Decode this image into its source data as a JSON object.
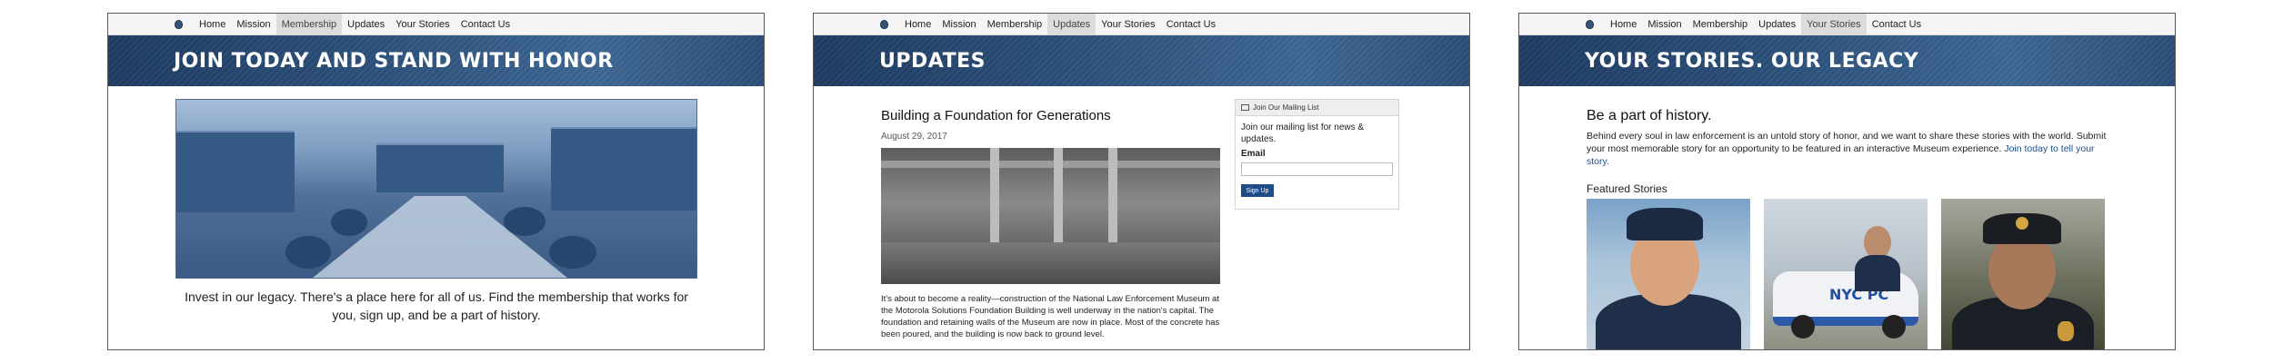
{
  "nav": {
    "items": [
      "Home",
      "Mission",
      "Membership",
      "Updates",
      "Your Stories",
      "Contact Us"
    ]
  },
  "screens": [
    {
      "active_nav": "Membership",
      "banner_title": "JOIN TODAY AND STAND WITH HONOR",
      "intro_text": "Invest in our legacy. There's a place here for all of us. Find the membership that works for you, sign up, and be a part of history."
    },
    {
      "active_nav": "Updates",
      "banner_title": "UPDATES",
      "post": {
        "title": "Building a Foundation for Generations",
        "date": "August 29, 2017",
        "body": "It's about to become a reality—construction of the National Law Enforcement Museum at the Motorola Solutions Foundation Building is well underway in the nation's capital. The foundation and retaining walls of the Museum are now in place. Most of the concrete has been poured, and the building is now back to ground level."
      },
      "mailing": {
        "header": "Join Our Mailing List",
        "text": "Join our mailing list for news & updates.",
        "email_label": "Email",
        "email_value": "",
        "button": "Sign Up"
      }
    },
    {
      "active_nav": "Your Stories",
      "banner_title": "YOUR STORIES. OUR LEGACY",
      "heading": "Be a part of history.",
      "body": "Behind every soul in law enforcement is an untold story of honor, and we want to share these stories with the world. Submit your most memorable story for an opportunity to be featured in an interactive Museum experience.",
      "link": "Join today to tell your story.",
      "featured_label": "Featured Stories",
      "car_text": "NYC PC"
    }
  ],
  "colors": {
    "banner": "#2e547f",
    "button": "#1e4c86",
    "link": "#1e4f8c"
  }
}
